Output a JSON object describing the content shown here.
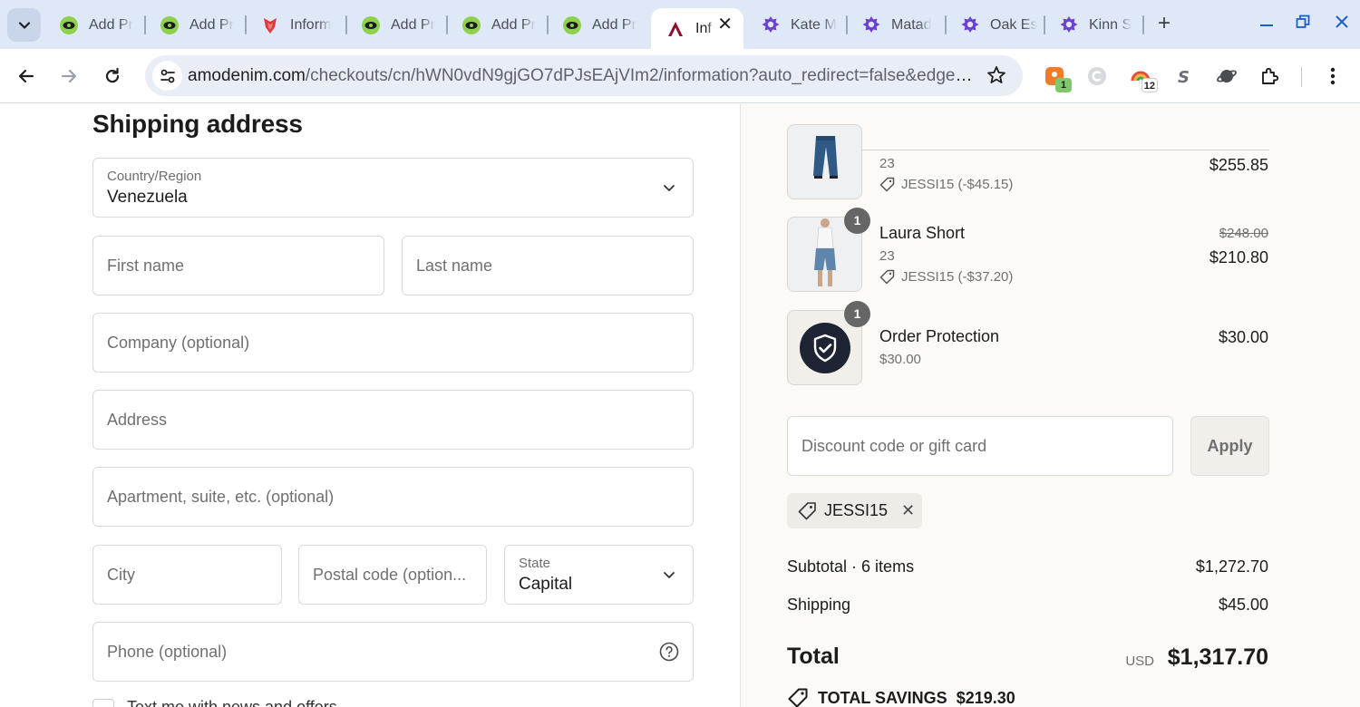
{
  "browser": {
    "tabs": [
      {
        "label": "Add Pr",
        "icon": "green-eye-icon"
      },
      {
        "label": "Add Pr",
        "icon": "green-eye-icon"
      },
      {
        "label": "Inform",
        "icon": "red-shield-icon"
      },
      {
        "label": "Add Pr",
        "icon": "green-eye-icon"
      },
      {
        "label": "Add Pr",
        "icon": "green-eye-icon"
      },
      {
        "label": "Add Pr",
        "icon": "green-eye-icon"
      },
      {
        "label": "Inf",
        "icon": "amo-a-icon",
        "active": true
      },
      {
        "label": "Kate M",
        "icon": "purple-gear-icon"
      },
      {
        "label": "Matad",
        "icon": "purple-gear-icon"
      },
      {
        "label": "Oak Es",
        "icon": "purple-gear-icon"
      },
      {
        "label": "Kinn S",
        "icon": "purple-gear-icon"
      }
    ],
    "url_host": "amodenim.com",
    "url_path": "/checkouts/cn/hWN0vdN9gjGO7dPJsEAjVIm2/information?auto_redirect=false&edge_r...",
    "extensions": {
      "ext1_badge": "1",
      "ext3_badge": "12"
    },
    "colors": {
      "tabstrip": "#dfe8f7",
      "accent": "#1a5fc7"
    }
  },
  "checkout": {
    "section_title": "Shipping address",
    "country": {
      "label": "Country/Region",
      "value": "Venezuela"
    },
    "first_name": {
      "placeholder": "First name"
    },
    "last_name": {
      "placeholder": "Last name"
    },
    "company": {
      "placeholder": "Company (optional)"
    },
    "address": {
      "placeholder": "Address"
    },
    "apartment": {
      "placeholder": "Apartment, suite, etc. (optional)"
    },
    "city": {
      "placeholder": "City"
    },
    "postal": {
      "placeholder": "Postal code (option..."
    },
    "state": {
      "label": "State",
      "value": "Capital"
    },
    "phone": {
      "placeholder": "Phone (optional)"
    },
    "checkbox_label": "Text me with news and offers"
  },
  "summary": {
    "items": [
      {
        "name": "",
        "variant": "23",
        "discount": "JESSI15 (-$45.15)",
        "price": "$255.85",
        "old_price": "",
        "qty": ""
      },
      {
        "name": "Laura Short",
        "variant": "23",
        "discount": "JESSI15 (-$37.20)",
        "price": "$210.80",
        "old_price": "$248.00",
        "qty": "1"
      },
      {
        "name": "Order Protection",
        "variant": "$30.00",
        "discount": "",
        "price": "$30.00",
        "old_price": "",
        "qty": "1"
      }
    ],
    "discount_placeholder": "Discount code or gift card",
    "apply_label": "Apply",
    "applied_code": "JESSI15",
    "subtotal_label": "Subtotal · 6 items",
    "subtotal_value": "$1,272.70",
    "shipping_label": "Shipping",
    "shipping_value": "$45.00",
    "total_label": "Total",
    "total_currency": "USD",
    "total_value": "$1,317.70",
    "savings_label": "TOTAL SAVINGS",
    "savings_value": "$219.30",
    "colors": {
      "panel_bg": "#fbfaf7",
      "badge": "#666666",
      "shield_bg": "#1e2433"
    }
  }
}
